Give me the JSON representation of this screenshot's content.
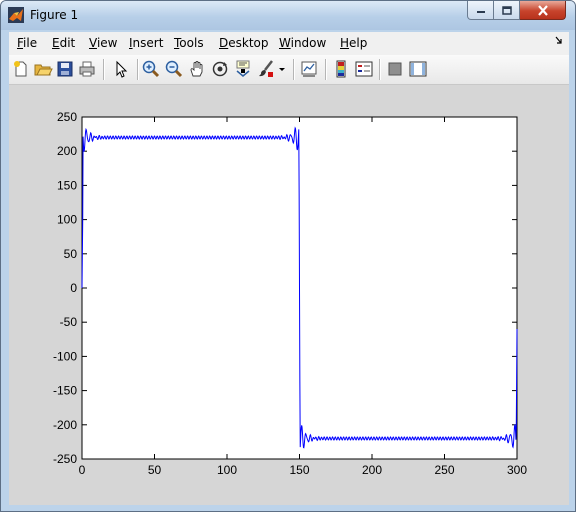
{
  "window": {
    "title": "Figure 1"
  },
  "menu": {
    "file": {
      "pre": "",
      "ul": "F",
      "post": "ile"
    },
    "edit": {
      "pre": "",
      "ul": "E",
      "post": "dit"
    },
    "view": {
      "pre": "",
      "ul": "V",
      "post": "iew"
    },
    "insert": {
      "pre": "",
      "ul": "I",
      "post": "nsert"
    },
    "tools": {
      "pre": "",
      "ul": "T",
      "post": "ools"
    },
    "desktop": {
      "pre": "",
      "ul": "D",
      "post": "esktop"
    },
    "window": {
      "pre": "",
      "ul": "W",
      "post": "indow"
    },
    "help": {
      "pre": "",
      "ul": "H",
      "post": "elp"
    }
  },
  "toolbar": {
    "icons": [
      "new-figure-icon",
      "open-file-icon",
      "save-icon",
      "print-icon",
      "pointer-icon",
      "zoom-in-icon",
      "zoom-out-icon",
      "pan-hand-icon",
      "rotate-3d-icon",
      "data-cursor-icon",
      "brush-icon",
      "brush-dropdown-icon",
      "link-plot-icon",
      "colorbar-icon",
      "legend-icon",
      "hide-plot-tools-icon",
      "show-plot-tools-icon"
    ]
  },
  "colors": {
    "line": "#0000ff",
    "plot_bg": "#ffffff",
    "figure_bg": "#d6d6d6"
  },
  "chart_data": {
    "type": "line",
    "title": "",
    "xlabel": "",
    "ylabel": "",
    "xlim": [
      0,
      300
    ],
    "ylim": [
      -250,
      250
    ],
    "xticks": [
      0,
      50,
      100,
      150,
      200,
      250,
      300
    ],
    "yticks": [
      250,
      200,
      150,
      100,
      50,
      0,
      -50,
      -100,
      -150,
      -200,
      -250
    ],
    "grid": false,
    "legend": "none",
    "series": [
      {
        "color": "#0000ff",
        "description_points": {
          "x": [
            0,
            1,
            3,
            5,
            10,
            50,
            100,
            140,
            147,
            149,
            150,
            151,
            153,
            155,
            160,
            200,
            250,
            290,
            297,
            299,
            300
          ],
          "y": [
            0,
            210,
            243,
            205,
            220,
            220,
            220,
            220,
            230,
            215,
            0,
            -215,
            -232,
            -215,
            -220,
            -220,
            -220,
            -220,
            -232,
            -215,
            -60
          ]
        },
        "shape": "square wave, amplitude ~220, period 300, with Gibbs ringing at transitions"
      }
    ]
  }
}
